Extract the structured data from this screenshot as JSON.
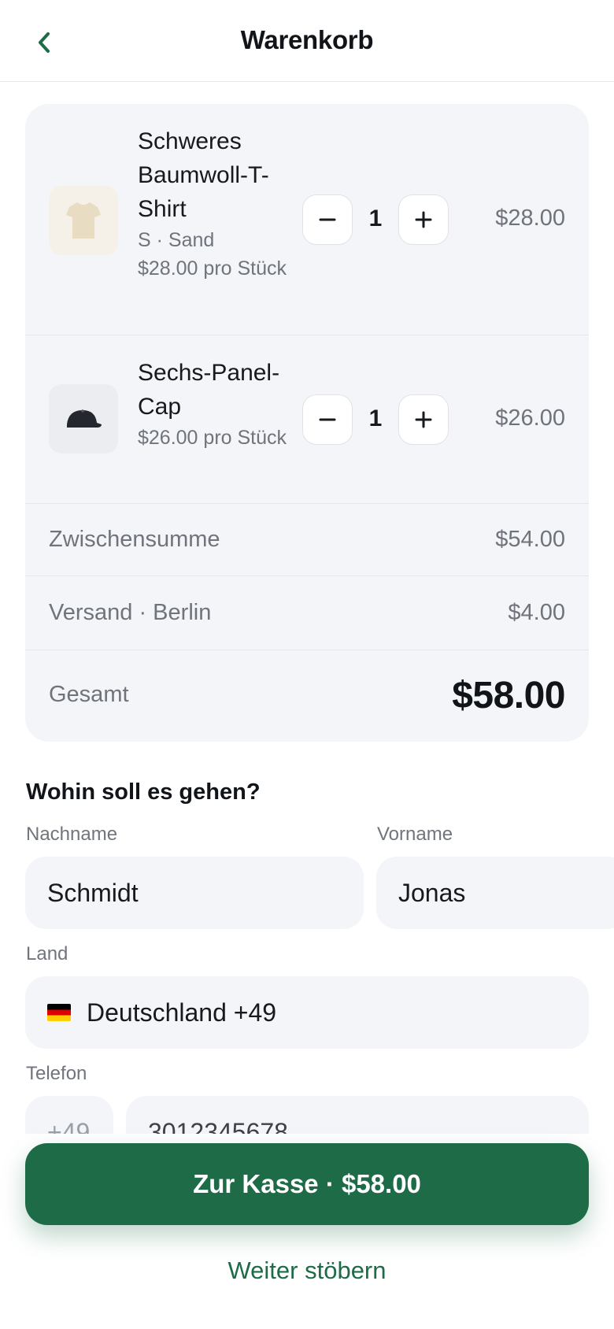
{
  "header": {
    "title": "Warenkorb",
    "back_icon": "chevron-left-icon"
  },
  "colors": {
    "accent": "#1d6b47",
    "card": "#f4f5f8",
    "muted": "#6f747c"
  },
  "cart": {
    "items": [
      {
        "name": "Schweres Baumwoll-T-Shirt",
        "variant": "S · Sand",
        "unit_price": "$28.00 pro Stück",
        "quantity": "1",
        "line_total": "$28.00",
        "icon": "tshirt-icon"
      },
      {
        "name": "Sechs-Panel-Cap",
        "unit_price": "$26.00 pro Stück",
        "quantity": "1",
        "line_total": "$26.00",
        "icon": "cap-icon"
      }
    ],
    "subtotal_label": "Zwischensumme",
    "subtotal_value": "$54.00",
    "shipping_label": "Versand · Berlin",
    "shipping_value": "$4.00",
    "total_label": "Gesamt",
    "total_value": "$58.00"
  },
  "form": {
    "title": "Wohin soll es gehen?",
    "last_name_label": "Nachname",
    "last_name_value": "Schmidt",
    "first_name_label": "Vorname",
    "first_name_value": "Jonas",
    "country_label": "Land",
    "country_value": "Deutschland +49",
    "phone_label": "Telefon",
    "phone_prefix": "+49",
    "phone_value": "3012345678"
  },
  "actions": {
    "checkout_label": "Zur Kasse · $58.00",
    "continue_label": "Weiter stöbern"
  }
}
